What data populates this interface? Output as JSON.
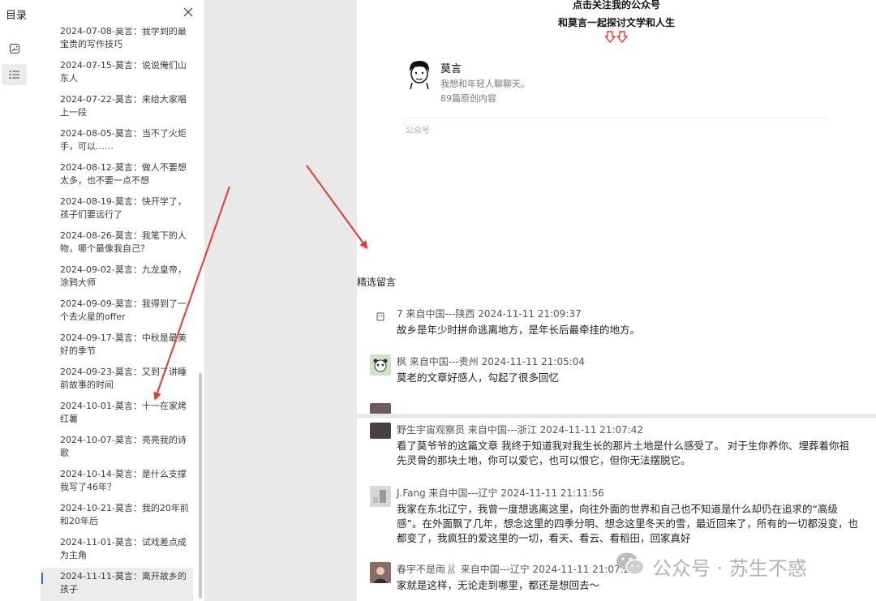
{
  "sidebar": {
    "title": "目录",
    "toc_items": [
      {
        "label": "2024-07-08-莫言：我学到的最宝贵的写作技巧",
        "active": false
      },
      {
        "label": "2024-07-15-莫言：说说俺们山东人",
        "active": false
      },
      {
        "label": "2024-07-22-莫言：来给大家唱上一段",
        "active": false
      },
      {
        "label": "2024-08-05-莫言：当不了火炬手，可以……",
        "active": false
      },
      {
        "label": "2024-08-12-莫言：做人不要想太多，也不要一点不想",
        "active": false
      },
      {
        "label": "2024-08-19-莫言：快开学了，孩子们要远行了",
        "active": false
      },
      {
        "label": "2024-08-26-莫言：我笔下的人物，哪个最像我自己？",
        "active": false
      },
      {
        "label": "2024-09-02-莫言：九龙皇帝，涂鸦大师",
        "active": false
      },
      {
        "label": "2024-09-09-莫言：我得到了一个去火星的offer",
        "active": false
      },
      {
        "label": "2024-09-17-莫言：中秋是最美好的季节",
        "active": false
      },
      {
        "label": "2024-09-23-莫言：又到了讲睡前故事的时间",
        "active": false
      },
      {
        "label": "2024-10-01-莫言：十一在家烤红薯",
        "active": false
      },
      {
        "label": "2024-10-07-莫言：亮亮我的诗歌",
        "active": false
      },
      {
        "label": "2024-10-14-莫言：是什么支撑我写了46年？",
        "active": false
      },
      {
        "label": "2024-10-21-莫言：我的20年前和20年后",
        "active": false
      },
      {
        "label": "2024-11-01-莫言：试戏差点成为主角",
        "active": false
      },
      {
        "label": "2024-11-11-莫言：离开故乡的孩子",
        "active": true
      }
    ]
  },
  "article": {
    "follow_line_1": "点击关注我的公众号",
    "follow_line_2": "和莫言一起探讨文学和人生",
    "hand_icons": "👇👇",
    "author": {
      "name": "莫言",
      "bio": "我想和年轻人聊聊天。",
      "count": "89篇原创内容",
      "account_type": "公众号"
    },
    "comments_label": "精选留言",
    "comments_top": [
      {
        "head": "7 来自中国---陕西 2024-11-11 21:09:37",
        "body": "故乡是年少时拼命逃离地方，是年长后最牵挂的地方。"
      },
      {
        "head": "枫 来自中国---贵州 2024-11-11 21:05:04",
        "body": "莫老的文章好感人，勾起了很多回忆"
      }
    ],
    "comments_bottom": [
      {
        "head": "野生宇宙观察员 来自中国---浙江 2024-11-11 21:07:42",
        "body": "看了莫爷爷的这篇文章 我终于知道我对我生长的那片土地是什么感受了。 对于生你养你、埋葬着你祖先灵骨的那块土地，你可以爱它，也可以恨它，但你无法摆脱它。"
      },
      {
        "head": "J.Fang 来自中国---辽宁 2024-11-11 21:11:56",
        "body": "我家在东北辽宁，我曾一度想逃离这里，向往外面的世界和自己也不知道是什么却仍在追求的“高级感”。在外面飘了几年，想念这里的四季分明、想念这里冬天的雪，最近回来了，所有的一切都没变，也都变了，我疯狂的爱这里的一切，看天、看云、看稻田，回家真好"
      },
      {
        "head": "春宇不是雨🐰 来自中国---辽宁 2024-11-11 21:07:22",
        "body": "家就是这样，无论走到哪里，都还是想回去～"
      }
    ]
  },
  "watermark": {
    "text": "公众号 · 苏生不惑"
  },
  "colors": {
    "arrow": "#e8382c",
    "toc_active_bar": "#2f6fd6",
    "gray_bg": "#e9e9e9"
  }
}
